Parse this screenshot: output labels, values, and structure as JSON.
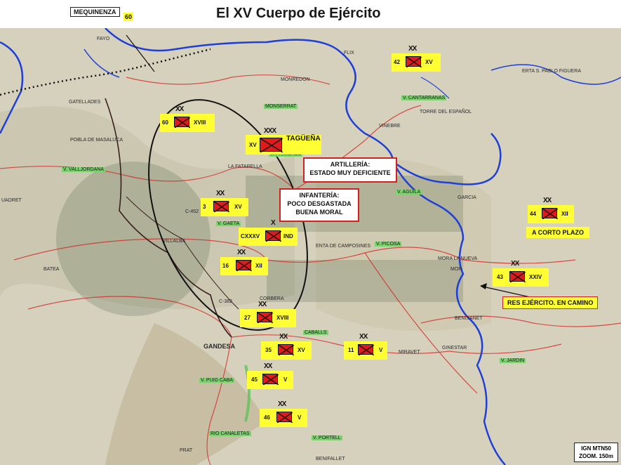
{
  "title": "El XV Cuerpo de Ejército",
  "labels": {
    "mequinenza": "MEQUINENZA",
    "mequinenza_num": "60",
    "reserve": "RES EJÉRCITO. EN CAMINO",
    "short_term": "A CORTO PLAZO",
    "scale_line1": "IGN MTN50",
    "scale_line2": "ZOOM. 150m"
  },
  "notes": {
    "artillery_title": "ARTILLERÍA:",
    "artillery_text": "ESTADO MUY DEFICIENTE",
    "infantry_title": "INFANTERÍA:",
    "infantry_line2": "POCO DESGASTADA",
    "infantry_line3": "BUENA MORAL"
  },
  "units": [
    {
      "id": "u42",
      "num": "42",
      "rank": "XX",
      "corps": "XV"
    },
    {
      "id": "u60",
      "num": "60",
      "rank": "XX",
      "corps": "XVIII"
    },
    {
      "id": "uxv",
      "num": "XV",
      "rank": "XXX",
      "corps": "TAGÜEÑA"
    },
    {
      "id": "u3",
      "num": "3",
      "rank": "XX",
      "corps": "XV"
    },
    {
      "id": "ucxxxv",
      "num": "CXXXV",
      "rank": "X",
      "corps": "IND"
    },
    {
      "id": "u16",
      "num": "16",
      "rank": "XX",
      "corps": "XII"
    },
    {
      "id": "u44",
      "num": "44",
      "rank": "XX",
      "corps": "XII"
    },
    {
      "id": "u43",
      "num": "43",
      "rank": "XX",
      "corps": "XXIV"
    },
    {
      "id": "u27",
      "num": "27",
      "rank": "XX",
      "corps": "XVIII"
    },
    {
      "id": "u35",
      "num": "35",
      "rank": "XX",
      "corps": "XV"
    },
    {
      "id": "u11",
      "num": "11",
      "rank": "XX",
      "corps": "V"
    },
    {
      "id": "u45",
      "num": "45",
      "rank": "XX",
      "corps": "V"
    },
    {
      "id": "u46",
      "num": "46",
      "rank": "XX",
      "corps": "V"
    }
  ],
  "places": {
    "fayon": "FAYO",
    "flix": "FLIX",
    "monredon": "MONREDON",
    "gatelladies": "GATELLADES",
    "monserrat": "MONSERRAT",
    "pobla": "POBLA DE MASALUCA",
    "torre": "TORRE DEL ESPAÑOL",
    "vinebre": "VINEBRE",
    "fatarella": "LA FATARELLA",
    "valljordana": "V. VALLJORDANA",
    "gaeta": "V. GAETA",
    "villalba": "VILLALBA",
    "batea": "BATEA",
    "camposines": "ENTA DE CAMPOSINES",
    "picosa": "V. PICOSA",
    "aguila": "V. AGUILA",
    "garcia": "GARCIA",
    "mora_nueva": "MORA LA NUEVA",
    "mora": "MOR",
    "corbera": "CORBERA",
    "gandesa": "GANDESA",
    "caballs": "CABALLS",
    "miravet": "MIRAVET",
    "benisanet": "BENISANET",
    "ginestar": "GINESTAR",
    "puig_caba": "V. PUIG CABA",
    "rio_canaletas": "RIO CANALETAS",
    "portell": "V. PORTELL",
    "prat": "PRAT",
    "benifallet": "BENIFALLET",
    "jardin": "V. JARDIN",
    "figuera": "ERTA S. PABLO FIGUERA",
    "cantarranas": "V. CANTARRANAS",
    "primeres": "V. PRIMERES",
    "c452": "C-452",
    "c382": "C-382",
    "uadret": "UADRET"
  },
  "colors": {
    "river": "#1f3fd6",
    "road": "#d42020",
    "front": "#111111",
    "unit_bg": "#ffff33",
    "unit_symbol": "#e01b1b",
    "note_border": "#d42020"
  }
}
